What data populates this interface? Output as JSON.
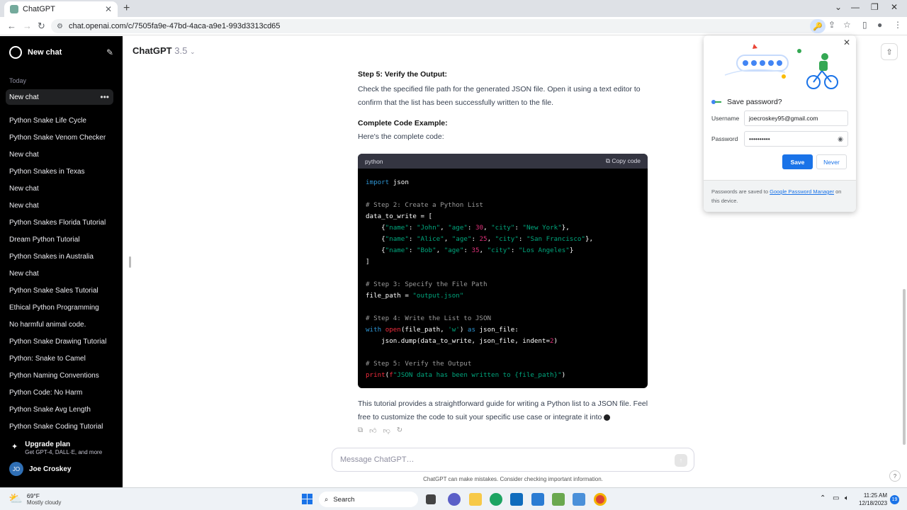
{
  "browser": {
    "tab_title": "ChatGPT",
    "tab_close": "✕",
    "new_tab": "+",
    "url": "chat.openai.com/c/7505fa9e-47bd-4aca-a9e1-993d3313cd65"
  },
  "sidebar": {
    "new_chat_label": "New chat",
    "section_today": "Today",
    "active_chat": "New chat",
    "items": [
      {
        "label": "Python Snake Life Cycle"
      },
      {
        "label": "Python Snake Venom Checker"
      },
      {
        "label": "New chat"
      },
      {
        "label": "Python Snakes in Texas"
      },
      {
        "label": "New chat"
      },
      {
        "label": "New chat"
      },
      {
        "label": "Python Snakes Florida Tutorial"
      },
      {
        "label": "Dream Python Tutorial"
      },
      {
        "label": "Python Snakes in Australia"
      },
      {
        "label": "New chat"
      },
      {
        "label": "Python Snake Sales Tutorial"
      },
      {
        "label": "Ethical Python Programming"
      },
      {
        "label": "No harmful animal code."
      },
      {
        "label": "Python Snake Drawing Tutorial"
      },
      {
        "label": "Python: Snake to Camel"
      },
      {
        "label": "Python Naming Conventions"
      },
      {
        "label": "Python Code: No Harm"
      },
      {
        "label": "Python Snake Avg Length"
      },
      {
        "label": "Python Snake Coding Tutorial"
      }
    ],
    "upgrade_title": "Upgrade plan",
    "upgrade_subtitle": "Get GPT-4, DALL·E, and more",
    "user_initials": "JO",
    "user_name": "Joe Croskey"
  },
  "header": {
    "model_name": "ChatGPT",
    "model_version": "3.5"
  },
  "message": {
    "step5_heading": "Step 5: Verify the Output:",
    "step5_body": "Check the specified file path for the generated JSON file. Open it using a text editor to confirm that the list has been successfully written to the file.",
    "complete_heading": "Complete Code Example:",
    "complete_body": "Here's the complete code:",
    "code_language": "python",
    "copy_label": "Copy code",
    "outro": "This tutorial provides a straightforward guide for writing a Python list to a JSON file. Feel free to customize the code to suit your specific use case or integrate it into"
  },
  "code_lines": [
    "import json",
    "",
    "# Step 2: Create a Python List",
    "data_to_write = [",
    "    {\"name\": \"John\", \"age\": 30, \"city\": \"New York\"},",
    "    {\"name\": \"Alice\", \"age\": 25, \"city\": \"San Francisco\"},",
    "    {\"name\": \"Bob\", \"age\": 35, \"city\": \"Los Angeles\"}",
    "]",
    "",
    "# Step 3: Specify the File Path",
    "file_path = \"output.json\"",
    "",
    "# Step 4: Write the List to JSON",
    "with open(file_path, 'w') as json_file:",
    "    json.dump(data_to_write, json_file, indent=2)",
    "",
    "# Step 5: Verify the Output",
    "print(f\"JSON data has been written to {file_path}\")"
  ],
  "composer": {
    "placeholder": "Message ChatGPT…",
    "disclaimer": "ChatGPT can make mistakes. Consider checking important information."
  },
  "help_label": "?",
  "password_popup": {
    "title": "Save password?",
    "username_label": "Username",
    "username_value": "joecroskey95@gmail.com",
    "password_label": "Password",
    "password_value": "••••••••••",
    "save_label": "Save",
    "never_label": "Never",
    "footer_prefix": "Passwords are saved to ",
    "footer_link": "Google Password Manager",
    "footer_suffix": " on this device.",
    "close_label": "✕"
  },
  "taskbar": {
    "weather_temp": "69°F",
    "weather_desc": "Mostly cloudy",
    "search_label": "Search",
    "time": "11:25 AM",
    "date": "12/18/2023",
    "notification_count": "19"
  },
  "colors": {
    "accent": "#1a73e8",
    "sidebar_bg": "#000000",
    "code_keyword": "#2e95d3",
    "code_string": "#00a67d",
    "code_number": "#df3079"
  }
}
